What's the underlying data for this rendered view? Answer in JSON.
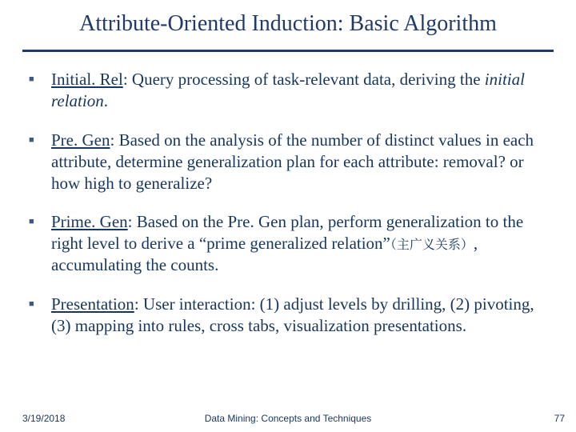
{
  "title": "Attribute-Oriented Induction: Basic Algorithm",
  "items": [
    {
      "label": "Initial. Rel",
      "sep": ": ",
      "text_a": "Query processing of task-relevant data, deriving the ",
      "italic": "initial relation",
      "text_b": "."
    },
    {
      "label": "Pre. Gen",
      "sep": ":  ",
      "text_a": "Based on the analysis of the number of distinct values in each attribute, determine generalization plan for each attribute: removal? or how high to generalize?",
      "italic": "",
      "text_b": ""
    },
    {
      "label": "Prime. Gen",
      "sep": ": ",
      "text_a": "Based on the Pre. Gen plan, perform generalization to the right level to derive a “prime generalized relation”",
      "cjk": "（主广义关系）",
      "text_b": ", accumulating the counts."
    },
    {
      "label": "Presentation",
      "sep": ": ",
      "text_a": "User interaction: (1) adjust levels by drilling, (2) pivoting, (3) mapping into rules, cross tabs, visualization presentations.",
      "italic": "",
      "text_b": ""
    }
  ],
  "footer": {
    "date": "3/19/2018",
    "center": "Data Mining: Concepts and Techniques",
    "page": "77"
  }
}
